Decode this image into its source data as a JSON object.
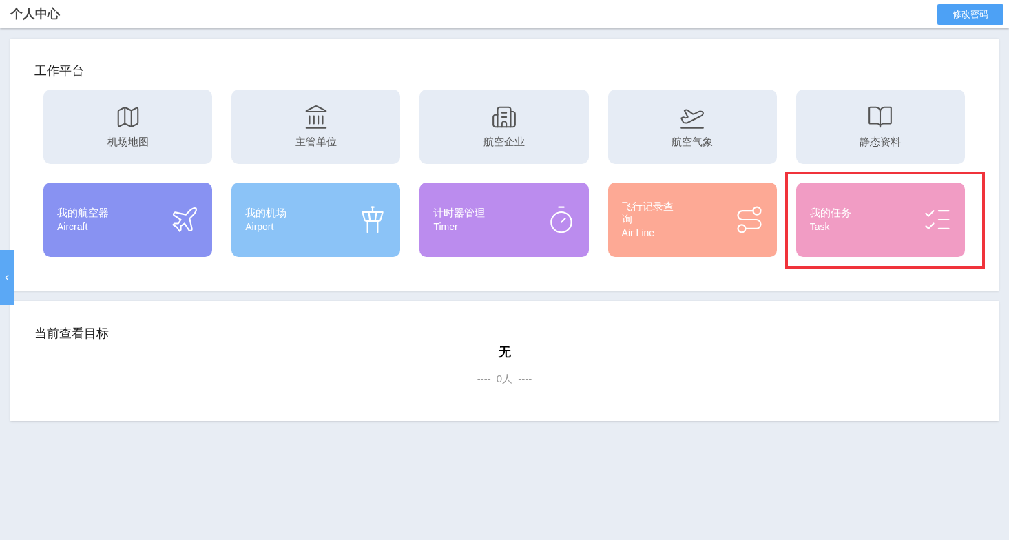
{
  "header": {
    "title": "个人中心",
    "button": "修改密码"
  },
  "workbench": {
    "title": "工作平台",
    "tiles": [
      {
        "label": "机场地图"
      },
      {
        "label": "主管单位"
      },
      {
        "label": "航空企业"
      },
      {
        "label": "航空气象"
      },
      {
        "label": "静态资料"
      }
    ],
    "shortcuts": [
      {
        "label": "我的航空器",
        "english": "Aircraft",
        "color": "#8892f2",
        "highlighted": false
      },
      {
        "label": "我的机场",
        "english": "Airport",
        "color": "#8bc3f7",
        "highlighted": false
      },
      {
        "label": "计时器管理",
        "english": "Timer",
        "color": "#bb8cee",
        "highlighted": false
      },
      {
        "label": "飞行记录查询",
        "english": "Air Line",
        "color": "#fda995",
        "highlighted": false
      },
      {
        "label": "我的任务",
        "english": "Task",
        "color": "#f19cc4",
        "highlighted": true
      }
    ]
  },
  "target": {
    "title": "当前查看目标",
    "name": "无",
    "left_dash": "----",
    "count": "0人",
    "right_dash": "----"
  }
}
